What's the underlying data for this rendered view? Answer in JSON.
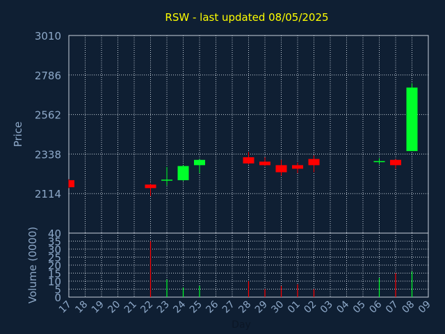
{
  "chart_data": {
    "type": "candlestick",
    "title": "RSW - last updated 08/05/2025",
    "xlabel": "Day",
    "price_ylabel": "Price",
    "volume_ylabel": "Volume (0000)",
    "price_yticks": [
      2114,
      2338,
      2562,
      2786,
      3010
    ],
    "price_ylim": [
      1890,
      3010
    ],
    "volume_yticks": [
      0,
      5,
      10,
      15,
      20,
      25,
      30,
      35
    ],
    "volume_ylim": [
      0,
      40
    ],
    "volume_top_label": "40",
    "days": [
      "17",
      "18",
      "19",
      "20",
      "21",
      "22",
      "23",
      "24",
      "25",
      "26",
      "27",
      "28",
      "29",
      "30",
      "01",
      "02",
      "03",
      "04",
      "05",
      "06",
      "07",
      "08",
      "09"
    ],
    "candles": [
      {
        "day": "17",
        "open": 2190,
        "close": 2150,
        "high": 2195,
        "low": 2145,
        "volume": 0
      },
      {
        "day": "22",
        "open": 2165,
        "close": 2145,
        "high": 2170,
        "low": 2100,
        "volume": 35
      },
      {
        "day": "23",
        "open": 2190,
        "close": 2190,
        "high": 2265,
        "low": 2160,
        "volume": 11
      },
      {
        "day": "24",
        "open": 2190,
        "close": 2270,
        "high": 2275,
        "low": 2185,
        "volume": 6
      },
      {
        "day": "25",
        "open": 2275,
        "close": 2305,
        "high": 2310,
        "low": 2230,
        "volume": 7
      },
      {
        "day": "28",
        "open": 2320,
        "close": 2285,
        "high": 2350,
        "low": 2280,
        "volume": 10
      },
      {
        "day": "29",
        "open": 2295,
        "close": 2275,
        "high": 2320,
        "low": 2270,
        "volume": 5
      },
      {
        "day": "30",
        "open": 2275,
        "close": 2235,
        "high": 2305,
        "low": 2215,
        "volume": 7
      },
      {
        "day": "01",
        "open": 2275,
        "close": 2255,
        "high": 2290,
        "low": 2230,
        "volume": 8
      },
      {
        "day": "02",
        "open": 2310,
        "close": 2275,
        "high": 2330,
        "low": 2235,
        "volume": 5
      },
      {
        "day": "06",
        "open": 2295,
        "close": 2295,
        "high": 2315,
        "low": 2280,
        "volume": 12
      },
      {
        "day": "07",
        "open": 2305,
        "close": 2275,
        "high": 2310,
        "low": 2255,
        "volume": 15
      },
      {
        "day": "08",
        "open": 2355,
        "close": 2715,
        "high": 2740,
        "low": 2355,
        "volume": 16
      }
    ],
    "colors": {
      "up": "#00ff2a",
      "down": "#ff0000",
      "title": "#ffff00",
      "grid": "#c8d2dc",
      "axis": "#8ea9c9"
    },
    "grid": true
  }
}
